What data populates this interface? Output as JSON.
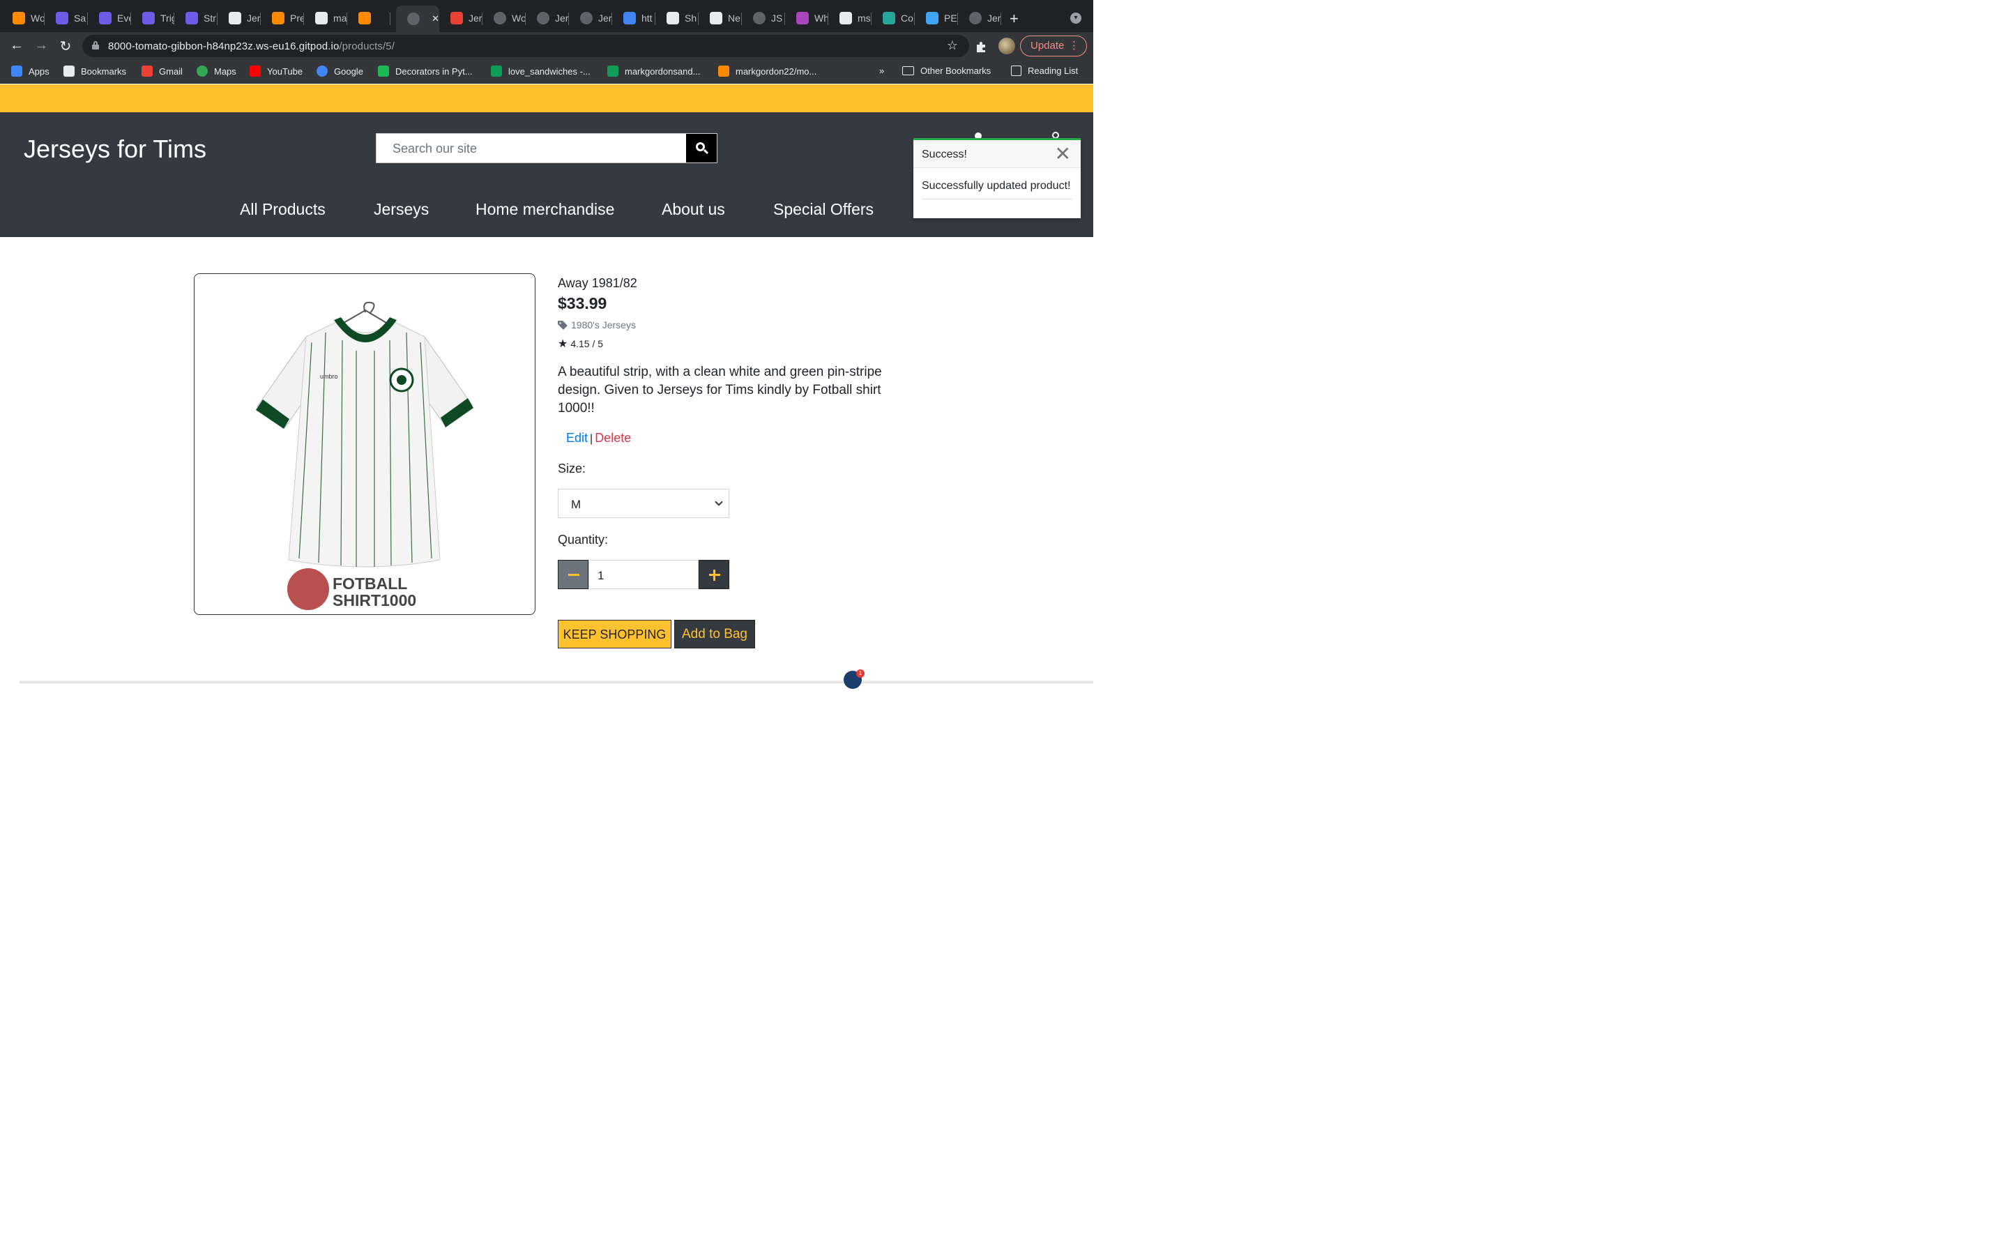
{
  "browser": {
    "tabs": [
      {
        "label": "Wo",
        "icon": "gitpod-icon",
        "color": "#ff8a00"
      },
      {
        "label": "Sa",
        "icon": "s-icon",
        "color": "#6c5ce7"
      },
      {
        "label": "Eve",
        "icon": "s-icon",
        "color": "#6c5ce7"
      },
      {
        "label": "Trig",
        "icon": "s-icon",
        "color": "#6c5ce7"
      },
      {
        "label": "Str",
        "icon": "s-icon",
        "color": "#6c5ce7"
      },
      {
        "label": "Jer",
        "icon": "github-icon",
        "color": "#e8eaed"
      },
      {
        "label": "Pre",
        "icon": "gitpod-icon",
        "color": "#ff8a00"
      },
      {
        "label": "ma",
        "icon": "github-icon",
        "color": "#e8eaed"
      },
      {
        "label": "",
        "icon": "gitpod-icon",
        "color": "#ff8a00"
      },
      {
        "label": "",
        "icon": "globe-icon",
        "color": "#5f6368"
      },
      {
        "label": "Jer",
        "icon": "gmail-icon",
        "color": "#ea4335"
      },
      {
        "label": "Wo",
        "icon": "globe-icon",
        "color": "#5f6368"
      },
      {
        "label": "Jer",
        "icon": "globe-icon",
        "color": "#5f6368"
      },
      {
        "label": "Jer",
        "icon": "globe-icon",
        "color": "#5f6368"
      },
      {
        "label": "htt",
        "icon": "google-icon",
        "color": "#4285f4"
      },
      {
        "label": "Sh",
        "icon": "nu-icon",
        "color": "#e8eaed"
      },
      {
        "label": "Ne",
        "icon": "smiley-icon",
        "color": "#e8eaed"
      },
      {
        "label": "JS",
        "icon": "globe-icon",
        "color": "#5f6368"
      },
      {
        "label": "Wh",
        "icon": "color-icon",
        "color": "#ab47bc"
      },
      {
        "label": "ms",
        "icon": "github-icon",
        "color": "#e8eaed"
      },
      {
        "label": "Co",
        "icon": "d-icon",
        "color": "#26a69a"
      },
      {
        "label": "PE",
        "icon": "pe-icon",
        "color": "#42a5f5"
      },
      {
        "label": "Jer",
        "icon": "globe-icon",
        "color": "#5f6368"
      }
    ],
    "url_host": "8000-tomato-gibbon-h84np23z.ws-eu16.gitpod.io",
    "url_path": "/products/5/",
    "update_label": "Update",
    "bookmarks": [
      {
        "label": "Apps",
        "icon": "apps-icon",
        "color": "#4285f4"
      },
      {
        "label": "Bookmarks",
        "icon": "star-icon",
        "color": "#e8eaed"
      },
      {
        "label": "Gmail",
        "icon": "gmail-icon",
        "color": "#ea4335"
      },
      {
        "label": "Maps",
        "icon": "maps-icon",
        "color": "#34a853"
      },
      {
        "label": "YouTube",
        "icon": "youtube-icon",
        "color": "#ff0000"
      },
      {
        "label": "Google",
        "icon": "google-icon",
        "color": "#4285f4"
      },
      {
        "label": "Decorators in Pyt...",
        "icon": "decorators-icon",
        "color": "#1db954"
      },
      {
        "label": "love_sandwiches -...",
        "icon": "sheets-icon",
        "color": "#0f9d58"
      },
      {
        "label": "markgordonsand...",
        "icon": "sheets-icon",
        "color": "#0f9d58"
      },
      {
        "label": "markgordon22/mo...",
        "icon": "gitpod-icon",
        "color": "#ff8a00"
      }
    ],
    "overflow_label": "»",
    "other_bookmarks": "Other Bookmarks",
    "reading_list": "Reading List"
  },
  "site": {
    "brand_color": "#ffc12e",
    "header_color": "#353a41",
    "logo": "Jerseys for Tims",
    "search_placeholder": "Search our site",
    "nav": [
      "All Products",
      "Jerseys",
      "Home merchandise",
      "About us",
      "Special Offers"
    ]
  },
  "toast": {
    "title": "Success!",
    "message": "Successfully updated product!"
  },
  "product": {
    "name": "Away 1981/82",
    "price": "$33.99",
    "category": "1980's Jerseys",
    "rating": "4.15 / 5",
    "description": "A beautiful strip, with a clean white and green pin-stripe design. Given to Jerseys for Tims kindly by Fotball shirt 1000!!",
    "edit_label": "Edit",
    "delete_label": "Delete",
    "image_watermark": [
      "FOTBALL",
      "SHIRT1000"
    ]
  },
  "form": {
    "size_label": "Size:",
    "size_value": "M",
    "quantity_label": "Quantity:",
    "quantity_value": "1",
    "keep_shopping": "KEEP SHOPPING",
    "add_to_bag": "Add to Bag"
  }
}
